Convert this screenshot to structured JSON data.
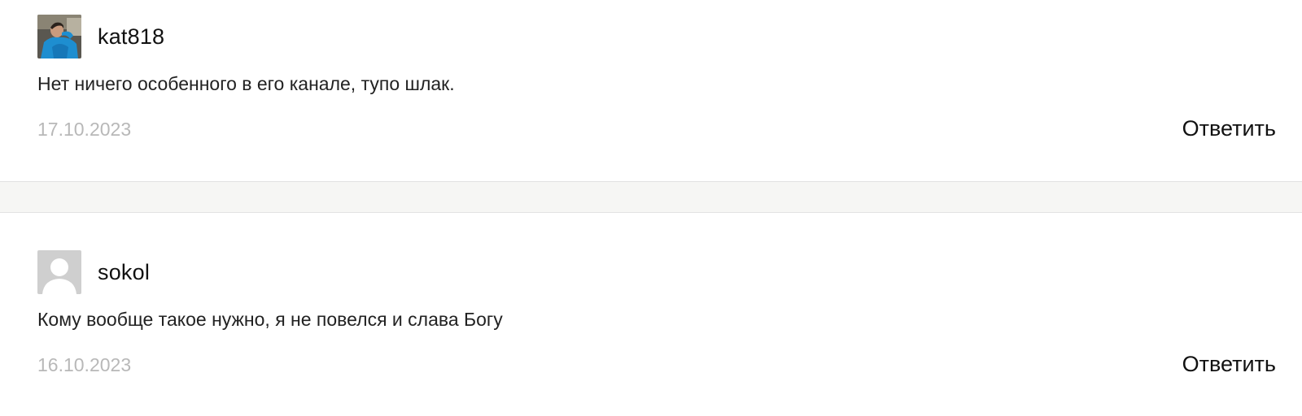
{
  "comments": [
    {
      "author": "kat818",
      "avatar_icon": "user-photo-avatar",
      "text": "Нет ничего особенного в его канале, тупо шлак.",
      "date": "17.10.2023",
      "reply_label": "Ответить"
    },
    {
      "author": "sokol",
      "avatar_icon": "default-user-avatar-icon",
      "text": "Кому вообще такое нужно, я не повелся и слава Богу",
      "date": "16.10.2023",
      "reply_label": "Ответить"
    }
  ],
  "colors": {
    "separator": "#f6f6f4",
    "date": "#b8b8b8",
    "text": "#222222",
    "default_avatar_bg": "#cfcfcf"
  }
}
